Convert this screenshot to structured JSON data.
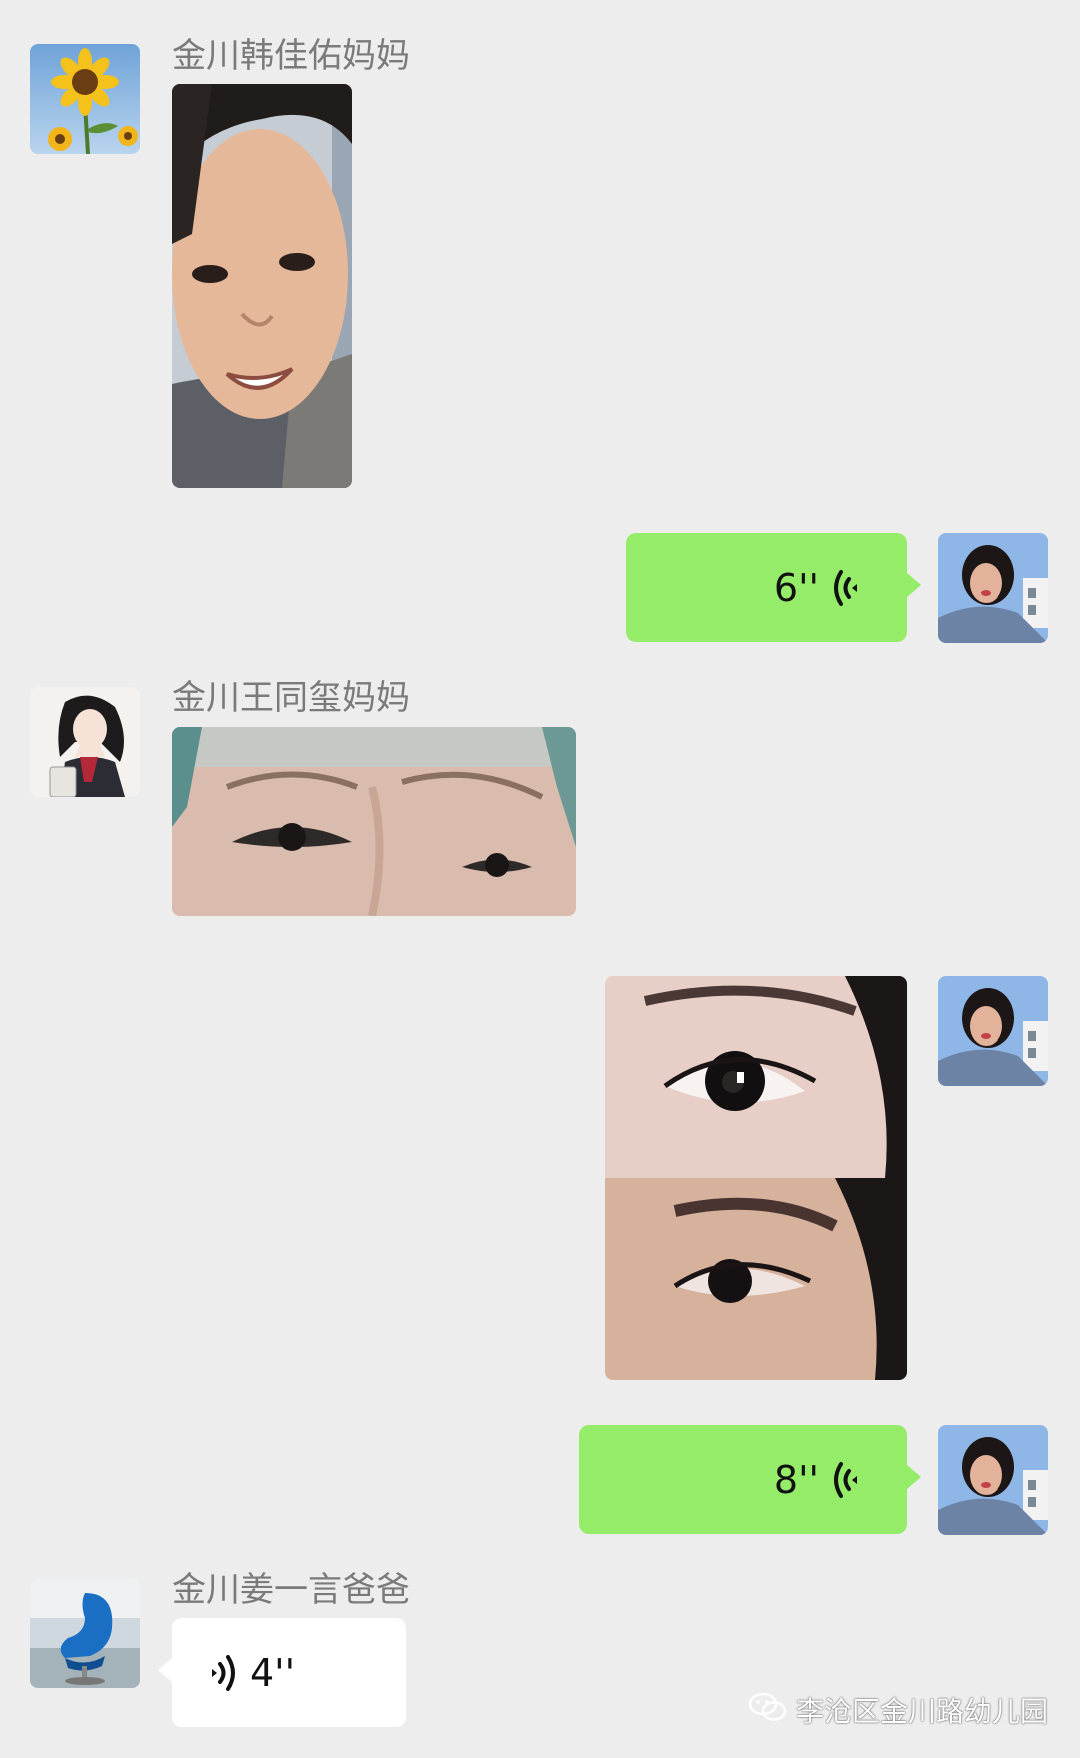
{
  "colors": {
    "background": "#ededed",
    "outgoing_bubble": "#95ec69",
    "incoming_bubble": "#ffffff",
    "name_text": "#7a7a7a"
  },
  "messages": [
    {
      "type": "image",
      "direction": "incoming",
      "sender": "金川韩佳佑妈妈",
      "avatar": "sunflower-avatar",
      "image": "child-face-photo"
    },
    {
      "type": "voice",
      "direction": "outgoing",
      "duration": "6''",
      "avatar": "self-avatar"
    },
    {
      "type": "image",
      "direction": "incoming",
      "sender": "金川王同玺妈妈",
      "avatar": "illustrated-woman-avatar",
      "image": "child-eyes-photo"
    },
    {
      "type": "image",
      "direction": "outgoing",
      "avatar": "self-avatar",
      "image": "adult-eyes-closeup-photo"
    },
    {
      "type": "voice",
      "direction": "outgoing",
      "duration": "8''",
      "avatar": "self-avatar"
    },
    {
      "type": "voice",
      "direction": "incoming",
      "sender": "金川姜一言爸爸",
      "duration": "4''",
      "avatar": "blue-chair-avatar"
    }
  ],
  "watermark": {
    "icon": "wechat-icon",
    "text": "李沧区金川路幼儿园"
  }
}
